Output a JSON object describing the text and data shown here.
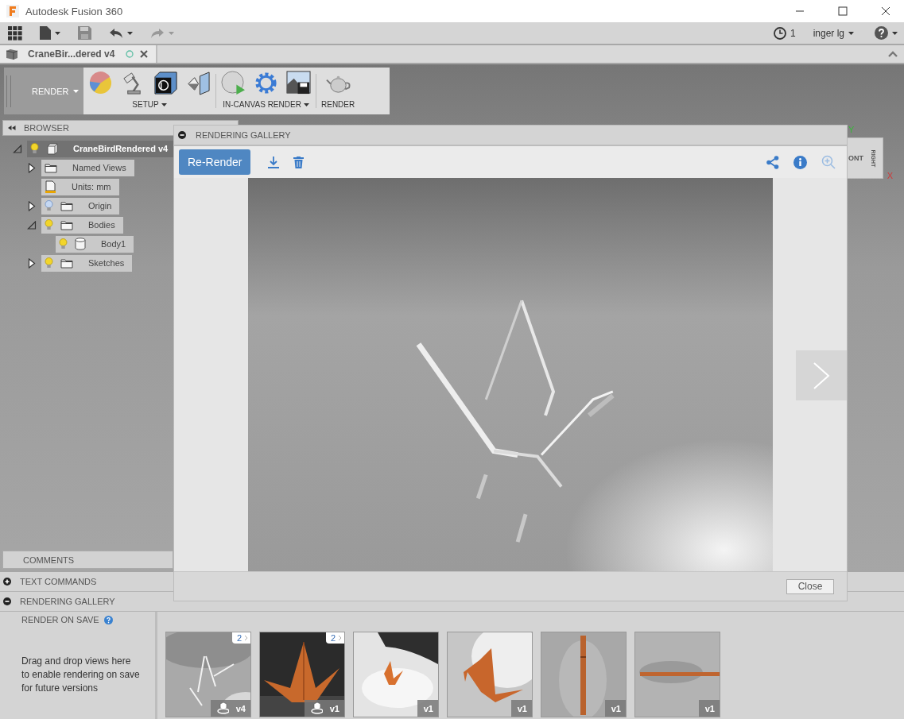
{
  "window": {
    "title": "Autodesk Fusion 360"
  },
  "quick_access": {
    "job_count": "1",
    "user": "inger lg"
  },
  "document_tab": {
    "title": "CraneBir...dered v4",
    "selected": true
  },
  "toolbar": {
    "workspace": "RENDER",
    "groups": [
      {
        "label": "SETUP",
        "has_menu": true
      },
      {
        "label": "IN-CANVAS RENDER",
        "has_menu": true
      },
      {
        "label": "RENDER",
        "has_menu": false
      }
    ]
  },
  "browser": {
    "title": "BROWSER",
    "tree": [
      {
        "label": "CraneBirdRendered v4",
        "kind": "component",
        "expanded": true,
        "visible": true,
        "selected": true,
        "children": [
          {
            "label": "Named Views",
            "kind": "folder",
            "expanded": false,
            "selected": false
          },
          {
            "label": "Units: mm",
            "kind": "units",
            "selected": false
          },
          {
            "label": "Origin",
            "kind": "folder",
            "expanded": false,
            "visible": false,
            "selected": false
          },
          {
            "label": "Bodies",
            "kind": "folder",
            "expanded": true,
            "visible": true,
            "selected": false,
            "children": [
              {
                "label": "Body1",
                "kind": "body",
                "visible": true,
                "selected": false
              }
            ]
          },
          {
            "label": "Sketches",
            "kind": "folder",
            "expanded": false,
            "visible": true,
            "selected": false
          }
        ]
      }
    ]
  },
  "viewcube": {
    "front": "ONT",
    "right": "RIGHT",
    "y_axis": "Y",
    "x_axis": "X"
  },
  "comments": {
    "title": "COMMENTS"
  },
  "panels": [
    {
      "title": "TEXT COMMANDS",
      "expanded": false
    },
    {
      "title": "RENDERING GALLERY",
      "expanded": true
    }
  ],
  "render_on_save": {
    "title": "RENDER ON SAVE",
    "hint": "Drag and drop views here to enable rendering on save for future versions"
  },
  "thumbnails": [
    {
      "kind": "picture",
      "count": "2",
      "version": "v4",
      "render_on_save": true
    },
    {
      "kind": "picture",
      "count": "2",
      "version": "v1",
      "render_on_save": true
    },
    {
      "kind": "picture",
      "version": "v1",
      "render_on_save": false
    },
    {
      "kind": "picture",
      "version": "v1",
      "render_on_save": false
    },
    {
      "kind": "picture",
      "version": "v1",
      "render_on_save": false
    },
    {
      "kind": "picture",
      "version": "v1",
      "render_on_save": false
    }
  ],
  "dialog": {
    "title": "RENDERING GALLERY",
    "rerender": "Re-Render",
    "close": "Close"
  }
}
